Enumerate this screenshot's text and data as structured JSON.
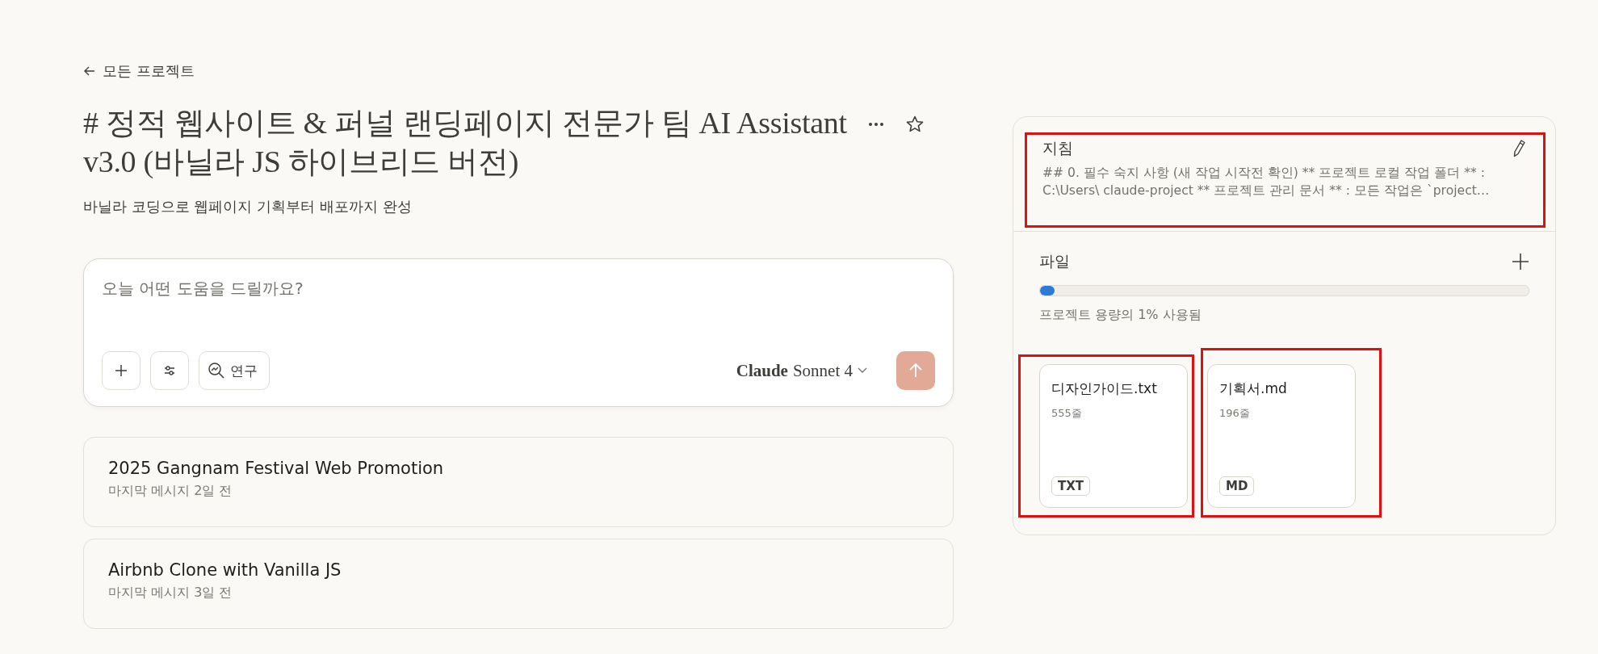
{
  "back_link": {
    "label": "모든 프로젝트"
  },
  "project": {
    "title": "# 정적 웹사이트 & 퍼널 랜딩페이지 전문가 팀 AI Assistant v3.0 (바닐라 JS 하이브리드 버전)",
    "description": "바닐라 코딩으로 웹페이지 기획부터 배포까지 완성",
    "starred": false
  },
  "composer": {
    "placeholder": "오늘 어떤 도움을 드릴까요?",
    "research_label": "연구",
    "model_brand": "Claude",
    "model_name": "Sonnet 4"
  },
  "conversations": [
    {
      "title": "2025 Gangnam Festival Web Promotion",
      "meta": "마지막 메시지 2일 전"
    },
    {
      "title": "Airbnb Clone with Vanilla JS",
      "meta": "마지막 메시지 3일 전"
    }
  ],
  "instructions": {
    "heading": "지침",
    "text": "## 0. 필수 숙지 사항 (새 작업 시작전 확인) ** 프로젝트 로컬 작업 폴더 ** : C:\\Users\\ claude-project ** 프로젝트 관리 문서 ** : 모든 작업은 `project…",
    "highlighted": true
  },
  "files_section": {
    "heading": "파일",
    "usage": {
      "level": 0.01,
      "label": "프로젝트 용량의 1% 사용됨"
    },
    "files": [
      {
        "name": "디자인가이드.txt",
        "lines": "555줄",
        "type": "TXT",
        "highlighted": true
      },
      {
        "name": "기획서.md",
        "lines": "196줄",
        "type": "MD",
        "highlighted": true
      }
    ]
  }
}
